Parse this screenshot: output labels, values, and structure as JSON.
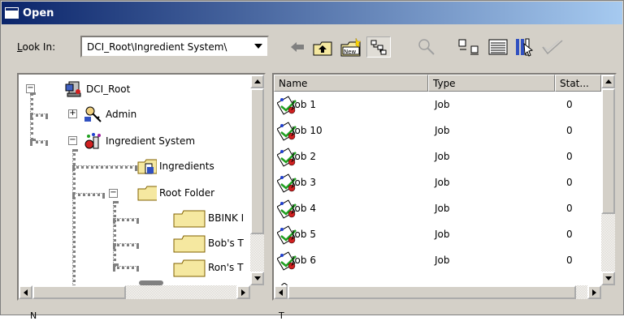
{
  "window": {
    "title": "Open"
  },
  "lookin": {
    "label_prefix": "L",
    "label_rest": "ook In:",
    "path": "DCI_Root\\Ingredient System\\"
  },
  "toolbar": {
    "buttons": [
      {
        "name": "back-arrow-icon"
      },
      {
        "name": "up-folder-icon"
      },
      {
        "name": "new-folder-icon"
      },
      {
        "name": "tree-view-icon"
      },
      {
        "name": "search-icon"
      },
      {
        "name": "list-view-icon"
      },
      {
        "name": "details-view-icon"
      },
      {
        "name": "properties-icon"
      },
      {
        "name": "checkmark-icon"
      }
    ],
    "new_badge": "New"
  },
  "tree": {
    "nodes": [
      {
        "label": "DCI_Root",
        "icon": "server-icon",
        "expander": "−"
      },
      {
        "label": "Admin",
        "icon": "admin-key-icon",
        "expander": "+"
      },
      {
        "label": "Ingredient System",
        "icon": "ingredient-system-icon",
        "expander": "−"
      },
      {
        "label": "Ingredients",
        "icon": "ingredients-folder-icon",
        "expander": ""
      },
      {
        "label": "Root Folder",
        "icon": "folder-icon",
        "expander": "−"
      },
      {
        "label": "BBINK I",
        "icon": "folder-icon",
        "expander": ""
      },
      {
        "label": "Bob's T",
        "icon": "folder-icon",
        "expander": ""
      },
      {
        "label": "Ron's T",
        "icon": "folder-icon",
        "expander": ""
      }
    ]
  },
  "list": {
    "columns": [
      "Name",
      "Type",
      "Stat..."
    ],
    "rows": [
      {
        "name": "Job 1",
        "type": "Job",
        "status": "0"
      },
      {
        "name": "Job 10",
        "type": "Job",
        "status": "0"
      },
      {
        "name": "Job 2",
        "type": "Job",
        "status": "0"
      },
      {
        "name": "Job 3",
        "type": "Job",
        "status": "0"
      },
      {
        "name": "Job 4",
        "type": "Job",
        "status": "0"
      },
      {
        "name": "Job 5",
        "type": "Job",
        "status": "0"
      },
      {
        "name": "Job 6",
        "type": "Job",
        "status": "0"
      }
    ]
  },
  "bottom": {
    "left_label": "N",
    "right_label": "T"
  }
}
